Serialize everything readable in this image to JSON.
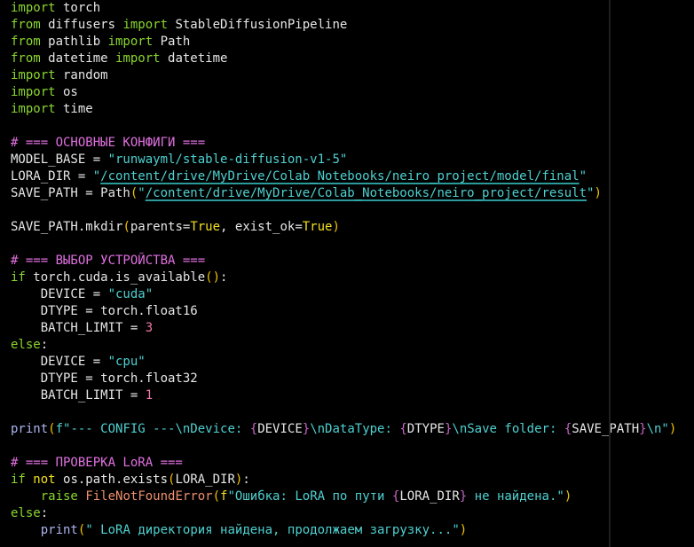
{
  "editor": {
    "colors": {
      "background": "#000000",
      "keyword": "#8ad62e",
      "comment": "#e070e0",
      "string": "#4fd0d0",
      "paren": "#f2c200",
      "number": "#f07aa8"
    },
    "lines": [
      [
        [
          "k",
          "import"
        ],
        [
          "t",
          " torch"
        ]
      ],
      [
        [
          "k",
          "from"
        ],
        [
          "t",
          " diffusers "
        ],
        [
          "k",
          "import"
        ],
        [
          "t",
          " StableDiffusionPipeline"
        ]
      ],
      [
        [
          "k",
          "from"
        ],
        [
          "t",
          " pathlib "
        ],
        [
          "k",
          "import"
        ],
        [
          "t",
          " Path"
        ]
      ],
      [
        [
          "k",
          "from"
        ],
        [
          "t",
          " datetime "
        ],
        [
          "k",
          "import"
        ],
        [
          "t",
          " datetime"
        ]
      ],
      [
        [
          "k",
          "import"
        ],
        [
          "t",
          " random"
        ]
      ],
      [
        [
          "k",
          "import"
        ],
        [
          "t",
          " os"
        ]
      ],
      [
        [
          "k",
          "import"
        ],
        [
          "t",
          " time"
        ]
      ],
      [],
      [
        [
          "c",
          "# === ОСНОВНЫЕ КОНФИГИ ==="
        ]
      ],
      [
        [
          "t",
          "MODEL_BASE = "
        ],
        [
          "s",
          "\"runwayml/stable-diffusion-v1-5\""
        ]
      ],
      [
        [
          "t",
          "LORA_DIR = "
        ],
        [
          "s",
          "\""
        ],
        [
          "su",
          "/content/drive/MyDrive/Colab_Notebooks/neiro_project/model/final"
        ],
        [
          "s",
          "\""
        ]
      ],
      [
        [
          "t",
          "SAVE_PATH = Path"
        ],
        [
          "p",
          "("
        ],
        [
          "s",
          "\""
        ],
        [
          "su",
          "/content/drive/MyDrive/Colab_Notebooks/neiro_project/result"
        ],
        [
          "s",
          "\""
        ],
        [
          "p",
          ")"
        ]
      ],
      [],
      [
        [
          "t",
          "SAVE_PATH.mkdir"
        ],
        [
          "p",
          "("
        ],
        [
          "t",
          "parents="
        ],
        [
          "y",
          "True"
        ],
        [
          "t",
          ", exist_ok="
        ],
        [
          "y",
          "True"
        ],
        [
          "p",
          ")"
        ]
      ],
      [],
      [
        [
          "c",
          "# === ВЫБОР УСТРОЙСТВА ==="
        ]
      ],
      [
        [
          "k",
          "if"
        ],
        [
          "t",
          " torch.cuda.is_available"
        ],
        [
          "p",
          "()"
        ],
        [
          "t",
          ":"
        ]
      ],
      [
        [
          "t",
          "    DEVICE = "
        ],
        [
          "s",
          "\"cuda\""
        ]
      ],
      [
        [
          "t",
          "    DTYPE = torch.float16"
        ]
      ],
      [
        [
          "t",
          "    BATCH_LIMIT = "
        ],
        [
          "n",
          "3"
        ]
      ],
      [
        [
          "k",
          "else"
        ],
        [
          "t",
          ":"
        ]
      ],
      [
        [
          "t",
          "    DEVICE = "
        ],
        [
          "s",
          "\"cpu\""
        ]
      ],
      [
        [
          "t",
          "    DTYPE = torch.float32"
        ]
      ],
      [
        [
          "t",
          "    BATCH_LIMIT = "
        ],
        [
          "n",
          "1"
        ]
      ],
      [],
      [
        [
          "b",
          "print"
        ],
        [
          "p",
          "("
        ],
        [
          "s",
          "f\"--- CONFIG ---\\nDevice: "
        ],
        [
          "m",
          "{"
        ],
        [
          "t",
          "DEVICE"
        ],
        [
          "m",
          "}"
        ],
        [
          "s",
          "\\nDataType: "
        ],
        [
          "m",
          "{"
        ],
        [
          "t",
          "DTYPE"
        ],
        [
          "m",
          "}"
        ],
        [
          "s",
          "\\nSave folder: "
        ],
        [
          "m",
          "{"
        ],
        [
          "t",
          "SAVE_PATH"
        ],
        [
          "m",
          "}"
        ],
        [
          "s",
          "\\n\""
        ],
        [
          "p",
          ")"
        ]
      ],
      [],
      [
        [
          "c",
          "# === ПРОВЕРКА LoRA ==="
        ]
      ],
      [
        [
          "k",
          "if"
        ],
        [
          "t",
          " "
        ],
        [
          "y",
          "not"
        ],
        [
          "t",
          " os.path.exists"
        ],
        [
          "p",
          "("
        ],
        [
          "t",
          "LORA_DIR"
        ],
        [
          "p",
          ")"
        ],
        [
          "t",
          ":"
        ]
      ],
      [
        [
          "t",
          "    "
        ],
        [
          "k",
          "raise"
        ],
        [
          "t",
          " "
        ],
        [
          "e",
          "FileNotFoundError"
        ],
        [
          "p",
          "("
        ],
        [
          "y",
          "f"
        ],
        [
          "s",
          "\"Ошибка: LoRA по пути "
        ],
        [
          "m",
          "{"
        ],
        [
          "t",
          "LORA_DIR"
        ],
        [
          "m",
          "}"
        ],
        [
          "s",
          " не найдена.\""
        ],
        [
          "p",
          ")"
        ]
      ],
      [
        [
          "k",
          "else"
        ],
        [
          "t",
          ":"
        ]
      ],
      [
        [
          "t",
          "    "
        ],
        [
          "b",
          "print"
        ],
        [
          "p",
          "("
        ],
        [
          "s",
          "\" LoRA директория найдена, продолжаем загрузку...\""
        ],
        [
          "p",
          ")"
        ]
      ]
    ]
  }
}
